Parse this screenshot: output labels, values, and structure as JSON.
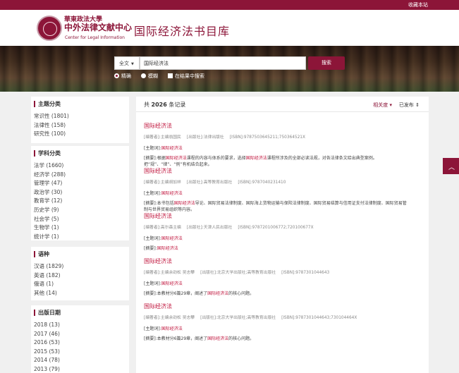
{
  "topbar": {
    "favorite_label": "收藏本站"
  },
  "header": {
    "logo_cn_line1": "華東政法大學",
    "logo_cn_line2": "中外法律文献中心",
    "logo_en": "Center for Legal Information",
    "site_title": "国际经济法书目库"
  },
  "search": {
    "scope": "全文",
    "query": "国际经济法",
    "button": "搜索",
    "options": {
      "exact": "精确",
      "fuzzy": "模糊",
      "within": "在结果中搜索"
    }
  },
  "facets": {
    "subject": {
      "title": "主题分类",
      "items": [
        "常识性 (1801)",
        "法律性 (158)",
        "研究性 (100)"
      ]
    },
    "discipline": {
      "title": "学科分类",
      "items": [
        "法学 (1660)",
        "经济学 (288)",
        "管理学 (47)",
        "政治学 (30)",
        "教育学 (12)",
        "历史学 (9)",
        "社会学 (5)",
        "生物学 (1)",
        "统计学 (1)"
      ]
    },
    "language": {
      "title": "语种",
      "items": [
        "汉语 (1829)",
        "英语 (182)",
        "俄语 (1)",
        "其他 (14)"
      ]
    },
    "pubdate": {
      "title": "出版日期",
      "items": [
        "2018 (13)",
        "2017 (46)",
        "2016 (53)",
        "2015 (53)",
        "2014 (78)",
        "2013 (79)"
      ]
    }
  },
  "results": {
    "count_prefix": "共",
    "count": "2026",
    "count_suffix": "条记录",
    "sort_relevance": "相关度",
    "sort_published": "已发布",
    "items": [
      {
        "title": "国际经济法",
        "author": "[编著者]:主编翁国民",
        "publisher": "[出版社]:法律出版社",
        "isbn": "[ISBN]:9787503645211;750364521X",
        "kw_prefix": "[主题词]:",
        "kw": "国际经济法",
        "ab_prefix": "[摘要]:根据",
        "ab_hl1": "国际经济法",
        "ab_mid": "课程的内容与体系的要求，选择",
        "ab_hl2": "国际经济法",
        "ab_tail": "课程所涉及的全部必读法规，对各法律条文给出典型案例。",
        "ab_line2": "把“规”、“律”、“例”有机结合起来。"
      },
      {
        "title": "国际经济法",
        "author": "[编著者]:主编胡加祥",
        "publisher": "[出版社]:高等教育出版社",
        "isbn": "[ISBN]:9787040231410",
        "kw_prefix": "[主题词]:",
        "kw": "国际经济法",
        "ab_prefix": "[摘要]:本书包括",
        "ab_hl1": "国际经济法",
        "ab_mid": "导论、国际贸易法律制度、国际海上货物运输与保险法律制度、国际贸易结算与信用证支付法律制度、国际贸易管",
        "ab_hl2": "",
        "ab_tail": "",
        "ab_line2": "制与世界贸易组织等内容。"
      },
      {
        "title": "国际经济法",
        "author": "[编著者]:高尔森主编",
        "publisher": "[出版社]:天津人民出版社",
        "isbn": "[ISBN]:9787201006772;720100677X",
        "kw_prefix": "[主题词]:",
        "kw": "国际经济法",
        "ab_prefix": "[摘要]:",
        "ab_hl1": "国际经济法",
        "ab_mid": "",
        "ab_hl2": "",
        "ab_tail": "",
        "ab_line2": ""
      },
      {
        "title": "国际经济法",
        "author": "[编著者]:主编余劲松 吴志攀",
        "publisher": "[出版社]:北京大学出版社;高等教育出版社",
        "isbn": "[ISBN]:9787301044643",
        "kw_prefix": "[主题词]:",
        "kw": "国际经济法",
        "ab_prefix": "[摘要]:本教材分6篇29章，阐述了",
        "ab_hl1": "国际经济法",
        "ab_mid": "的核心问题。",
        "ab_hl2": "",
        "ab_tail": "",
        "ab_line2": ""
      },
      {
        "title": "国际经济法",
        "author": "[编著者]:主编余劲松 吴志攀",
        "publisher": "[出版社]:北京大学出版社;高等教育出版社",
        "isbn": "[ISBN]:9787301044643;730104464X",
        "kw_prefix": "[主题词]:",
        "kw": "国际经济法",
        "ab_prefix": "[摘要]:本教材分6篇29章，阐述了",
        "ab_hl1": "国际经济法",
        "ab_mid": "的核心问题。",
        "ab_hl2": "",
        "ab_tail": "",
        "ab_line2": ""
      }
    ]
  },
  "colors": {
    "brand": "#8c1538",
    "highlight": "#c0143c"
  }
}
